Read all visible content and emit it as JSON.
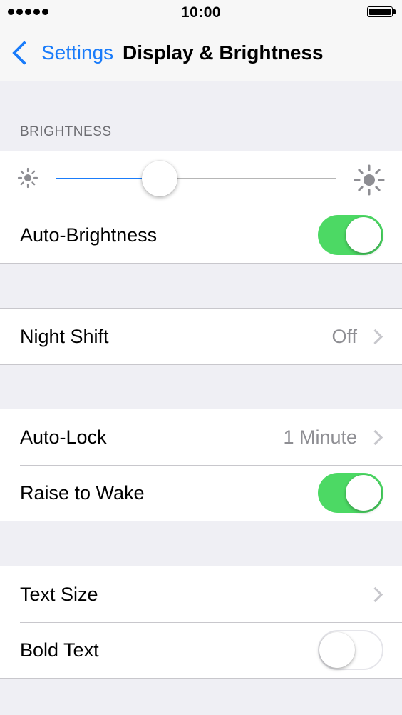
{
  "status_bar": {
    "time": "10:00",
    "signal_bars": 5,
    "battery_level": 1.0
  },
  "nav": {
    "back_label": "Settings",
    "title": "Display & Brightness"
  },
  "brightness": {
    "section_header": "BRIGHTNESS",
    "slider_value": 0.37,
    "auto_brightness_label": "Auto-Brightness",
    "auto_brightness_on": true
  },
  "night_shift": {
    "label": "Night Shift",
    "value": "Off"
  },
  "lock": {
    "auto_lock_label": "Auto-Lock",
    "auto_lock_value": "1 Minute",
    "raise_to_wake_label": "Raise to Wake",
    "raise_to_wake_on": true
  },
  "text": {
    "text_size_label": "Text Size",
    "bold_text_label": "Bold Text",
    "bold_text_on": false
  },
  "colors": {
    "accent": "#1a7cfa",
    "toggle_on": "#4cd964",
    "background": "#efeff4"
  },
  "icons": [
    "chevron-left-icon",
    "sun-small-icon",
    "sun-large-icon",
    "chevron-right-icon"
  ]
}
